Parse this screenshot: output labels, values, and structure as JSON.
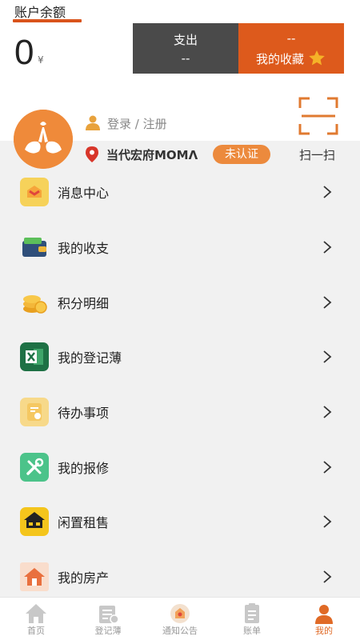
{
  "account": {
    "title": "账户余额",
    "balance": "0",
    "unit": "¥"
  },
  "cards": {
    "expense_label": "支出",
    "expense_value": "--",
    "fav_value": "--",
    "fav_label": "我的收藏"
  },
  "user": {
    "login": "登录 / 注册",
    "location": "当代宏府MOMΛ",
    "status_badge": "未认证",
    "scan_label": "扫一扫"
  },
  "menu": [
    {
      "label": "消息中心",
      "icon": "message-center-icon"
    },
    {
      "label": "我的收支",
      "icon": "wallet-icon"
    },
    {
      "label": "积分明细",
      "icon": "coins-icon"
    },
    {
      "label": "我的登记薄",
      "icon": "excel-book-icon"
    },
    {
      "label": "待办事项",
      "icon": "todo-icon"
    },
    {
      "label": "我的报修",
      "icon": "repair-tools-icon"
    },
    {
      "label": "闲置租售",
      "icon": "idle-rent-icon"
    },
    {
      "label": "我的房产",
      "icon": "house-icon"
    }
  ],
  "tabs": [
    {
      "label": "首页",
      "icon": "home-icon"
    },
    {
      "label": "登记薄",
      "icon": "register-icon"
    },
    {
      "label": "通知公告",
      "icon": "notice-icon"
    },
    {
      "label": "账单",
      "icon": "bill-icon"
    },
    {
      "label": "我的",
      "icon": "profile-icon"
    }
  ],
  "colors": {
    "accent": "#dd5a1c",
    "dark_card": "#4a4a4a",
    "badge": "#ec8a3d",
    "background": "#f1f1f1"
  }
}
